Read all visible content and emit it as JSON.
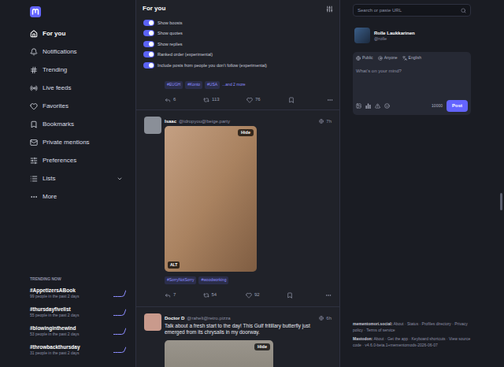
{
  "sidebar": {
    "items": [
      {
        "label": "For you",
        "selected": true,
        "expandable": false
      },
      {
        "label": "Notifications",
        "selected": false,
        "expandable": false
      },
      {
        "label": "Trending",
        "selected": false,
        "expandable": false
      },
      {
        "label": "Live feeds",
        "selected": false,
        "expandable": false
      },
      {
        "label": "Favorites",
        "selected": false,
        "expandable": false
      },
      {
        "label": "Bookmarks",
        "selected": false,
        "expandable": false
      },
      {
        "label": "Private mentions",
        "selected": false,
        "expandable": false
      },
      {
        "label": "Preferences",
        "selected": false,
        "expandable": false
      },
      {
        "label": "Lists",
        "selected": false,
        "expandable": true
      },
      {
        "label": "More",
        "selected": false,
        "expandable": false
      }
    ]
  },
  "trending": {
    "title": "TRENDING NOW",
    "tags": [
      {
        "name": "#AppetizersABook",
        "people": "99 people in the past 2 days",
        "history": [
          0,
          0,
          0,
          0,
          0,
          1,
          8
        ]
      },
      {
        "name": "#thursdayfivelist",
        "people": "55 people in the past 2 days",
        "history": [
          0,
          0,
          0,
          0,
          0,
          1,
          7
        ]
      },
      {
        "name": "#blowinginthewind",
        "people": "53 people in the past 2 days",
        "history": [
          0,
          0,
          0,
          0,
          0,
          1,
          7
        ]
      },
      {
        "name": "#throwbackthursday",
        "people": "31 people in the past 2 days",
        "history": [
          1,
          1,
          1,
          1,
          1,
          2,
          8
        ]
      }
    ]
  },
  "timeline": {
    "title": "For you",
    "settings": [
      {
        "label": "Show boosts",
        "on": true
      },
      {
        "label": "Show quotes",
        "on": true
      },
      {
        "label": "Show replies",
        "on": true
      },
      {
        "label": "Ranked order (experimental)",
        "on": true
      },
      {
        "label": "Include posts from people you don't follow (experimental)",
        "on": true
      }
    ],
    "previous_post": {
      "tags": [
        "#EUGH",
        "#Konto",
        "#USA"
      ],
      "more_tags": "...and 2 more",
      "actions": {
        "replies": "6",
        "boosts": "113",
        "favourites": "76"
      }
    },
    "posts": [
      {
        "name": "Isaac",
        "handle": "@idropyou@beige.party",
        "time": "7h",
        "text": "",
        "media": {
          "kind": "portrait",
          "hide_label": "Hide",
          "alt": "ALT"
        },
        "tags": [
          "#SorryNotSorry",
          "#woodworking"
        ],
        "actions": {
          "replies": "7",
          "boosts": "54",
          "favourites": "92"
        }
      },
      {
        "name": "Doctor D",
        "handle": "@rahelt@retro.pizza",
        "time": "6h",
        "text": "Talk about a fresh start to the day! This Gulf fritillary butterfly just emerged from its chrysalis in my doorway.",
        "media": {
          "kind": "landscape",
          "hide_label": "Hide",
          "alt": ""
        },
        "tags": [],
        "actions": null
      }
    ]
  },
  "search": {
    "placeholder": "Search or paste URL"
  },
  "account": {
    "name": "Rolle Laukkarinen",
    "handle": "@rolle"
  },
  "compose": {
    "visibility": "Public",
    "quote_policy": "Anyone",
    "language": "English",
    "placeholder": "What's on your mind?",
    "remaining": "10000",
    "button": "Post"
  },
  "footer": {
    "separator": "·",
    "sections": [
      {
        "label": "mementomori.social:",
        "links": [
          "About",
          "Status",
          "Profiles directory",
          "Privacy policy",
          "Terms of service"
        ],
        "version": ""
      },
      {
        "label": "Mastodon:",
        "links": [
          "About",
          "Get the app",
          "Keyboard shortcuts",
          "View source code"
        ],
        "version": "v4.6.0-beta.1+mementomods-2026-06-07"
      }
    ]
  }
}
